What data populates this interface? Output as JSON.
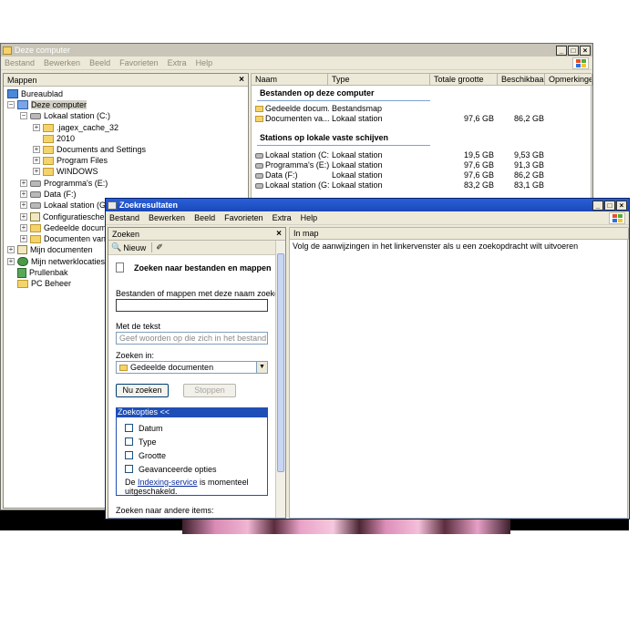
{
  "win1": {
    "title": "Deze computer",
    "menu": [
      "Bestand",
      "Bewerken",
      "Beeld",
      "Favorieten",
      "Extra",
      "Help"
    ],
    "folders_pane": {
      "title": "Mappen",
      "tree": [
        {
          "label": "Bureaublad"
        },
        {
          "label": "Deze computer"
        },
        {
          "label": "Lokaal station (C:)"
        },
        {
          "label": ".jagex_cache_32"
        },
        {
          "label": "2010"
        },
        {
          "label": "Documents and Settings"
        },
        {
          "label": "Program Files"
        },
        {
          "label": "WINDOWS"
        },
        {
          "label": "Programma's (E:)"
        },
        {
          "label": "Data (F:)"
        },
        {
          "label": "Lokaal station (G:)"
        },
        {
          "label": "Configuratieschern"
        },
        {
          "label": "Gedeelde documen"
        },
        {
          "label": "Documenten van"
        },
        {
          "label": "Mijn documenten"
        },
        {
          "label": "Mijn netwerklocaties"
        },
        {
          "label": "Prullenbak"
        },
        {
          "label": "PC Beheer"
        }
      ]
    },
    "columns": [
      "Naam",
      "Type",
      "Totale grootte",
      "Beschikbaar",
      "Opmerkingen"
    ],
    "groups": [
      {
        "title": "Bestanden op deze computer",
        "rows": [
          {
            "name": "Gedeelde docum...",
            "type": "Bestandsmap",
            "total": "",
            "free": ""
          },
          {
            "name": "Documenten va...",
            "type": "Lokaal station",
            "total": "97,6 GB",
            "free": "86,2 GB"
          }
        ]
      },
      {
        "title": "Stations op lokale vaste schijven",
        "rows": [
          {
            "name": "Lokaal station (C:)",
            "type": "Lokaal station",
            "total": "19,5 GB",
            "free": "9,53 GB"
          },
          {
            "name": "Programma's (E:)",
            "type": "Lokaal station",
            "total": "97,6 GB",
            "free": "91,3 GB"
          },
          {
            "name": "Data (F:)",
            "type": "Lokaal station",
            "total": "97,6 GB",
            "free": "86,2 GB"
          },
          {
            "name": "Lokaal station (G:)",
            "type": "Lokaal station",
            "total": "83,2 GB",
            "free": "83,1 GB"
          }
        ]
      }
    ]
  },
  "win2": {
    "title": "Zoekresultaten",
    "menu": [
      "Bestand",
      "Bewerken",
      "Beeld",
      "Favorieten",
      "Extra",
      "Help"
    ],
    "search_pane": {
      "title": "Zoeken",
      "new_label": "Nieuw",
      "heading": "Zoeken naar bestanden en mappen",
      "name_label": "Bestanden of mappen met deze naam zoeken:",
      "name_value": "",
      "text_label": "Met de tekst",
      "text_placeholder": "Geef woorden op die zich in het bestand bevin",
      "look_in_label": "Zoeken in:",
      "look_in_value": "Gedeelde documenten",
      "search_now": "Nu zoeken",
      "stop": "Stoppen",
      "options_header": "Zoekopties <<",
      "options": [
        "Datum",
        "Type",
        "Grootte",
        "Geavanceerde opties"
      ],
      "indexing_prefix": "De ",
      "indexing_link": "Indexing-service",
      "indexing_suffix": " is momenteel uitgeschakeld.",
      "other_items": "Zoeken naar andere items:"
    },
    "results": {
      "column": "In map",
      "message": "Volg de aanwijzingen in het linkervenster als u een zoekopdracht wilt uitvoeren"
    }
  },
  "colors": {
    "active_title": "#1a48b9",
    "inactive_title": "#c9c6b9",
    "window_face": "#ece9d8",
    "options_header": "#1f4fb6"
  }
}
